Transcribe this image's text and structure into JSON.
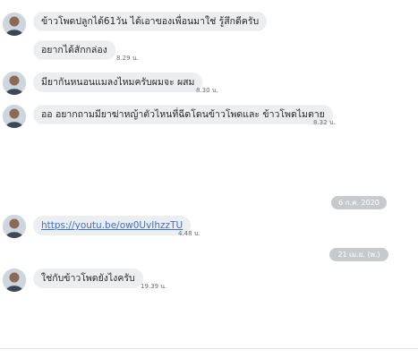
{
  "messages": [
    {
      "text": "ข้าวโพดปลูกได้61วัน ได้เอาของเพื่อนมาใช่ รู้สึกดีครับ",
      "time": ""
    },
    {
      "text": "อยากได้สักกล่อง",
      "time": "8.29 น."
    },
    {
      "text": "มียากันหนอนแมลงไหมครับผมจะ ผสม",
      "time": "8.30 น."
    },
    {
      "text": "ออ อยากถามมียาฆ่าหญ้าตัวไหนที่ฉีดโดนข้าวโพดและ ข้าวโพดไมตาย",
      "time": "8.32 น."
    },
    {
      "text": "https://youtu.be/ow0UvIhzzTU",
      "time": "4.48 น."
    },
    {
      "text": "ใช่กับข้าวโพดยังไงครับ",
      "time": "19.39 น."
    }
  ],
  "dates": [
    "6 ก.ค. 2020",
    "21 เม.ย. (พ.)"
  ]
}
